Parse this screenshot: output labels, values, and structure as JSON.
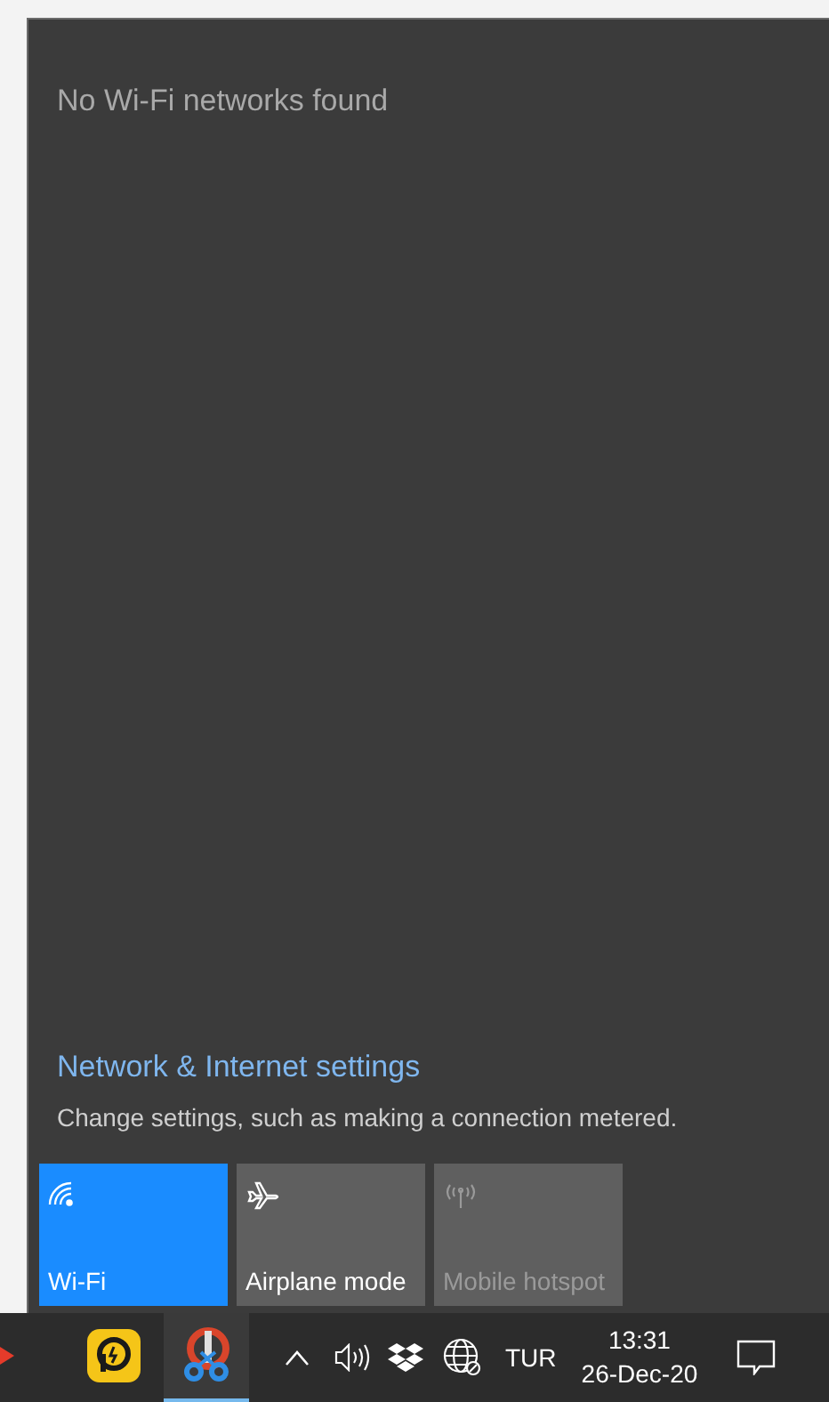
{
  "panel": {
    "message": "No Wi-Fi networks found",
    "settings_link": "Network & Internet settings",
    "settings_description": "Change settings, such as making a connection metered."
  },
  "quick_actions": [
    {
      "kind": "wifi",
      "label": "Wi-Fi",
      "on": true,
      "disabled": false
    },
    {
      "kind": "airplane",
      "label": "Airplane mode",
      "on": false,
      "disabled": false
    },
    {
      "kind": "hotspot",
      "label": "Mobile hotspot",
      "on": false,
      "disabled": true
    }
  ],
  "taskbar": {
    "apps": [
      {
        "kind": "arrow",
        "selected": false
      },
      {
        "kind": "yellow",
        "selected": false
      },
      {
        "kind": "scissors",
        "selected": true
      }
    ],
    "language": "TUR",
    "time": "13:31",
    "date": "26-Dec-20"
  }
}
